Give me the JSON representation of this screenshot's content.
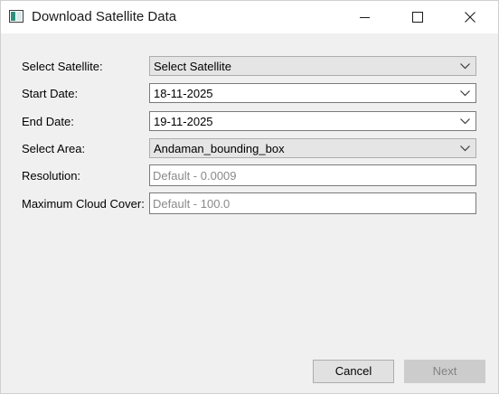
{
  "window": {
    "title": "Download Satellite Data"
  },
  "form": {
    "satellite": {
      "label": "Select Satellite:",
      "value": "Select Satellite"
    },
    "start_date": {
      "label": "Start Date:",
      "value": "18-11-2025"
    },
    "end_date": {
      "label": "End Date:",
      "value": "19-11-2025"
    },
    "area": {
      "label": "Select Area:",
      "value": "Andaman_bounding_box"
    },
    "resolution": {
      "label": "Resolution:",
      "placeholder": "Default - 0.0009"
    },
    "cloud_cover": {
      "label": "Maximum Cloud Cover:",
      "placeholder": "Default - 100.0"
    }
  },
  "buttons": {
    "cancel": "Cancel",
    "next": "Next"
  },
  "colors": {
    "window_bg": "#f0f0f0",
    "titlebar_bg": "#ffffff",
    "combo_bg": "#e5e5e5",
    "button_bg": "#e1e1e1",
    "disabled_bg": "#cccccc",
    "placeholder_text": "#8a8a8a"
  },
  "icons": {
    "app": "app-window-icon",
    "minimize": "minimize-icon",
    "maximize": "maximize-icon",
    "close": "close-icon",
    "dropdown": "chevron-down-icon"
  }
}
